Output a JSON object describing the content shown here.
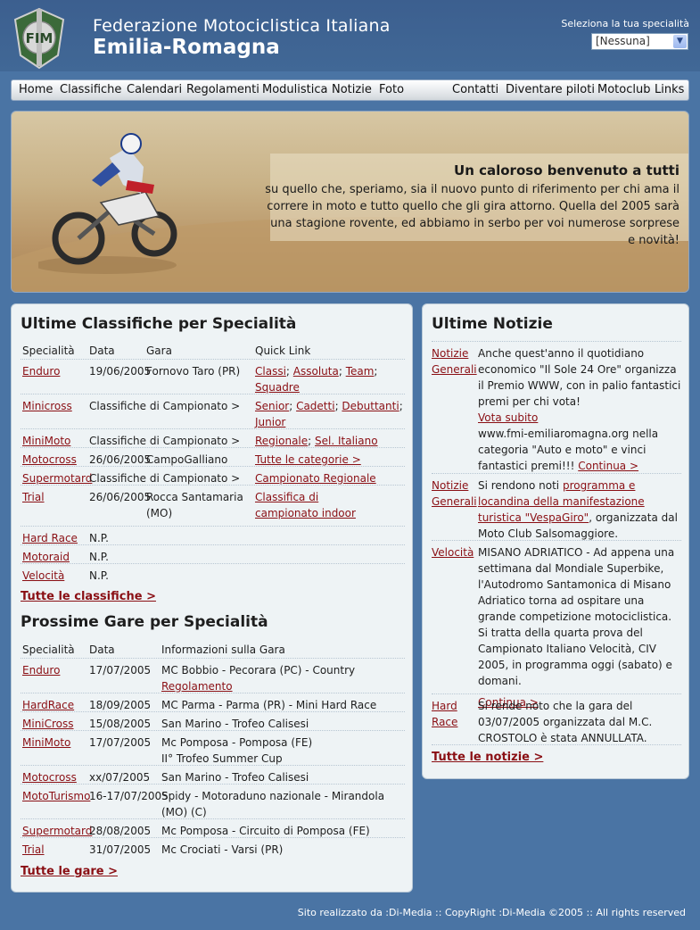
{
  "header": {
    "org": "Federazione Motociclistica Italiana",
    "region": "Emilia-Romagna",
    "spec_label": "Seleziona la tua specialità",
    "spec_value": "[Nessuna]",
    "logo_text": "FIM"
  },
  "nav": {
    "left": [
      "Home",
      "Classifiche",
      "Calendari",
      "Regolamenti",
      "Modulistica",
      "Notizie",
      "Foto"
    ],
    "right": [
      "Contatti",
      "Diventare piloti",
      "Motoclub",
      "Links"
    ]
  },
  "banner": {
    "title": "Un caloroso benvenuto a tutti",
    "text": "su quello che, speriamo, sia il nuovo punto di riferimento per chi ama il correre in moto e tutto quello che gli gira attorno. Quella del 2005 sarà una stagione rovente, ed abbiamo in serbo per voi numerose sorprese e novità!"
  },
  "classifiche": {
    "title": "Ultime Classifiche per Specialità",
    "headers": [
      "Specialità",
      "Data",
      "Gara",
      "Quick Link"
    ],
    "rows": [
      {
        "spec": "Enduro",
        "date": "19/06/2005",
        "gara": "Fornovo Taro (PR)",
        "links": "Classi; Assoluta; Team; Squadre"
      },
      {
        "spec": "Minicross",
        "date": "",
        "gara": "Classifiche di Campionato >",
        "links": "Senior; Cadetti; Debuttanti; Junior"
      },
      {
        "spec": "MiniMoto",
        "date": "",
        "gara": "Classifiche di Campionato >",
        "links": "Regionale; Sel. Italiano"
      },
      {
        "spec": "Motocross",
        "date": "26/06/2005",
        "gara": "CampoGalliano",
        "links": "Tutte le categorie >"
      },
      {
        "spec": "Supermotard",
        "date": "",
        "gara": "Classifiche di Campionato >",
        "links": "Campionato Regionale"
      },
      {
        "spec": "Trial",
        "date": "26/06/2005",
        "gara": "Rocca Santamaria (MO)",
        "links": "Classifica di campionato indoor"
      },
      {
        "spec": "Hard Race",
        "date": "N.P.",
        "gara": "",
        "links": ""
      },
      {
        "spec": "Motoraid",
        "date": "N.P.",
        "gara": "",
        "links": ""
      },
      {
        "spec": "Velocità",
        "date": "N.P.",
        "gara": "",
        "links": ""
      }
    ],
    "more": "Tutte le classifiche >"
  },
  "gare": {
    "title": "Prossime Gare per Specialità",
    "headers": [
      "Specialità",
      "Data",
      "Informazioni sulla Gara"
    ],
    "rows": [
      {
        "spec": "Enduro",
        "date": "17/07/2005",
        "info": "MC Bobbio - Pecorara (PC) - Country",
        "link": "Regolamento"
      },
      {
        "spec": "HardRace",
        "date": "18/09/2005",
        "info": "MC Parma - Parma (PR) - Mini Hard Race",
        "link": ""
      },
      {
        "spec": "MiniCross",
        "date": "15/08/2005",
        "info": "San Marino - Trofeo Calisesi",
        "link": ""
      },
      {
        "spec": "MiniMoto",
        "date": "17/07/2005",
        "info": "Mc Pomposa - Pomposa (FE)",
        "info2": "II° Trofeo Summer Cup",
        "link": ""
      },
      {
        "spec": "Motocross",
        "date": "xx/07/2005",
        "info": "San Marino - Trofeo Calisesi",
        "link": ""
      },
      {
        "spec": "MotoTurismo",
        "date": "16-17/07/2005",
        "info": "Spidy - Motoraduno nazionale - Mirandola (MO) (C)",
        "link": ""
      },
      {
        "spec": "Supermotard",
        "date": "28/08/2005",
        "info": "Mc Pomposa - Circuito di Pomposa (FE)",
        "link": ""
      },
      {
        "spec": "Trial",
        "date": "31/07/2005",
        "info": "Mc Crociati - Varsi (PR)",
        "link": ""
      }
    ],
    "more": "Tutte le gare >"
  },
  "notizie": {
    "title": "Ultime Notizie",
    "items": [
      {
        "cat": "Notizie Generali",
        "pre": "Anche quest'anno il quotidiano economico \"Il Sole 24 Ore\" organizza il Premio WWW, con in palio fantastici premi per chi vota!",
        "link": "Vota subito",
        "post": "www.fmi-emiliaromagna.org nella categoria \"Auto e moto\" e vinci fantastici premi!!!",
        "more": "Continua >"
      },
      {
        "cat": "Notizie Generali",
        "pre": "Si rendono noti",
        "link": "programma e locandina della manifestazione turistica \"VespaGiro\"",
        "post": ", organizzata dal Moto Club Salsomaggiore.",
        "more": ""
      },
      {
        "cat": "Velocità",
        "pre": "MISANO ADRIATICO - Ad appena una settimana dal Mondiale Superbike, l'Autodromo Santamonica di Misano Adriatico torna ad ospitare una grande competizione motociclistica. Si tratta della quarta prova del Campionato Italiano Velocità, CIV 2005, in programma oggi (sabato) e domani.",
        "link": "",
        "post": "",
        "more": "Continua >"
      },
      {
        "cat": "Hard Race",
        "pre": "Si rende noto che la gara del 03/07/2005 organizzata dal M.C. CROSTOLO è stata ANNULLATA.",
        "link": "",
        "post": "",
        "more": ""
      }
    ],
    "more": "Tutte le notizie >"
  },
  "footer": "Sito realizzato da :Di-Media :: CopyRight :Di-Media ©2005 :: All rights reserved"
}
